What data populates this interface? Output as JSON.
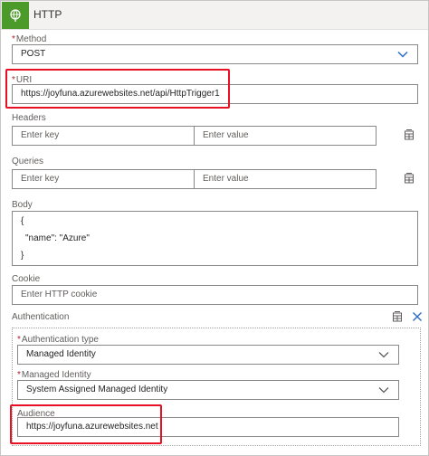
{
  "header": {
    "title": "HTTP",
    "icon": "globe-icon",
    "accent_color": "#4c9a2a"
  },
  "method": {
    "label": "Method",
    "required_mark": "*",
    "value": "POST"
  },
  "uri": {
    "label": "URI",
    "required_mark": "*",
    "value": "https://joyfuna.azurewebsites.net/api/HttpTrigger1"
  },
  "headers": {
    "label": "Headers",
    "key_placeholder": "Enter key",
    "value_placeholder": "Enter value"
  },
  "queries": {
    "label": "Queries",
    "key_placeholder": "Enter key",
    "value_placeholder": "Enter value"
  },
  "body": {
    "label": "Body",
    "lines": [
      "{",
      "\"name\": \"Azure\"",
      "}"
    ]
  },
  "cookie": {
    "label": "Cookie",
    "placeholder": "Enter HTTP cookie"
  },
  "authentication": {
    "label": "Authentication",
    "auth_type": {
      "label": "Authentication type",
      "required_mark": "*",
      "value": "Managed Identity"
    },
    "managed_identity": {
      "label": "Managed Identity",
      "required_mark": "*",
      "value": "System Assigned Managed Identity"
    },
    "audience": {
      "label": "Audience",
      "value": "https://joyfuna.azurewebsites.net"
    }
  },
  "highlight_color": "#e81123"
}
